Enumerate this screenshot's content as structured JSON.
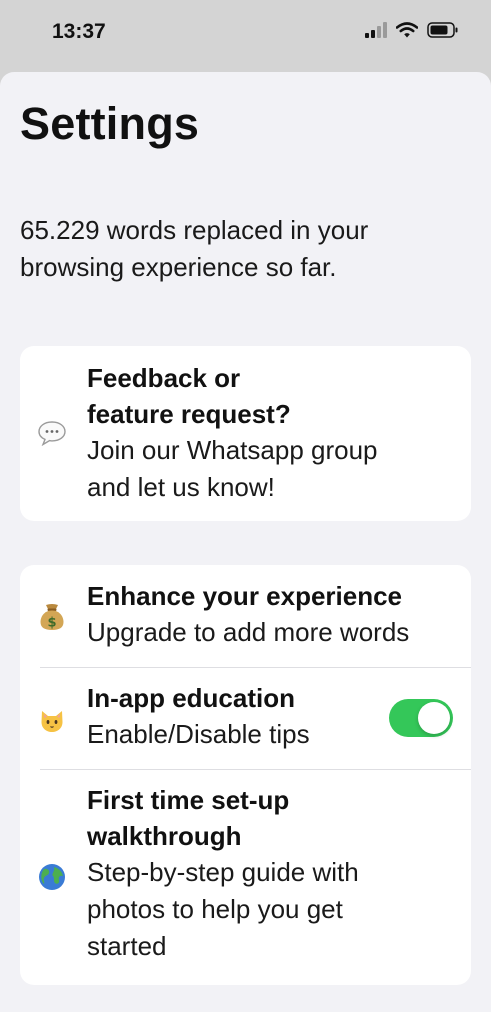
{
  "status_bar": {
    "time": "13:37",
    "icons": [
      "cellular-signal-icon",
      "wifi-icon",
      "battery-icon"
    ]
  },
  "page": {
    "title": "Settings",
    "summary": "65.229 words replaced in your browsing experience so far."
  },
  "feedback_card": {
    "icon": "speech-bubble-icon",
    "title_line1": "Feedback or",
    "title_line2": "feature request?",
    "subtitle_line1": "Join our Whatsapp group",
    "subtitle_line2": "and let us know!"
  },
  "settings": {
    "items": [
      {
        "icon": "money-bag-icon",
        "title": "Enhance your experience",
        "subtitle": "Upgrade to add more words"
      },
      {
        "icon": "cat-face-icon",
        "title": "In-app education",
        "subtitle": "Enable/Disable tips",
        "toggle_on": true
      },
      {
        "icon": "globe-icon",
        "title_line1": "First time set-up",
        "title_line2": "walkthrough",
        "subtitle_line1": "Step-by-step guide with",
        "subtitle_line2": "photos to help you get",
        "subtitle_line3": "started"
      }
    ]
  },
  "colors": {
    "toggle_on": "#34c759",
    "background": "#f2f2f6",
    "card": "#ffffff",
    "status_bar": "#d4d4d4"
  }
}
